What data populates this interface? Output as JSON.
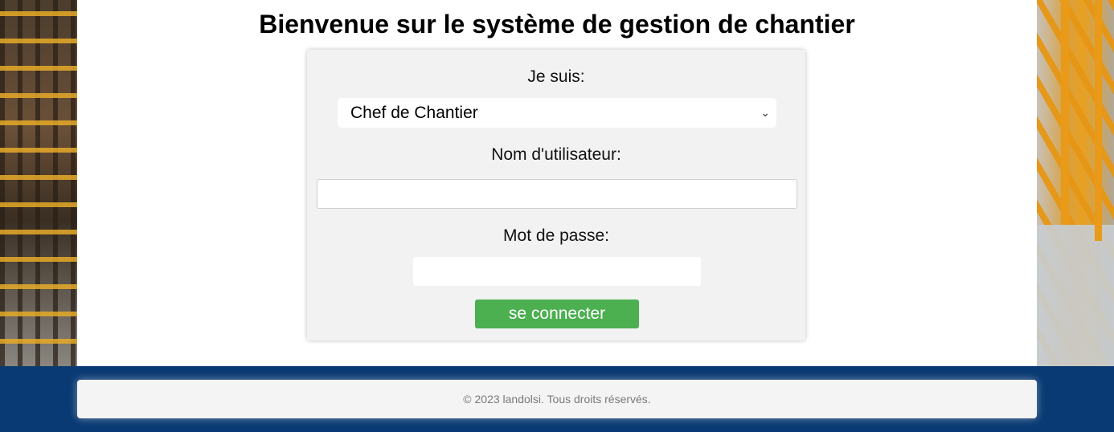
{
  "header": {
    "title": "Bienvenue sur le système de gestion de chantier"
  },
  "login_form": {
    "role_label": "Je suis:",
    "role_selected": "Chef de Chantier",
    "username_label": "Nom d'utilisateur:",
    "username_value": "",
    "password_label": "Mot de passe:",
    "password_value": "",
    "submit_label": "se connecter"
  },
  "footer": {
    "copyright": "© 2023 landolsi. Tous droits réservés."
  },
  "colors": {
    "button": "#4caf50",
    "footer_band": "#0a3a73",
    "form_background": "#f2f2f2"
  },
  "icons": {
    "select_caret": "chevron-down-icon"
  }
}
